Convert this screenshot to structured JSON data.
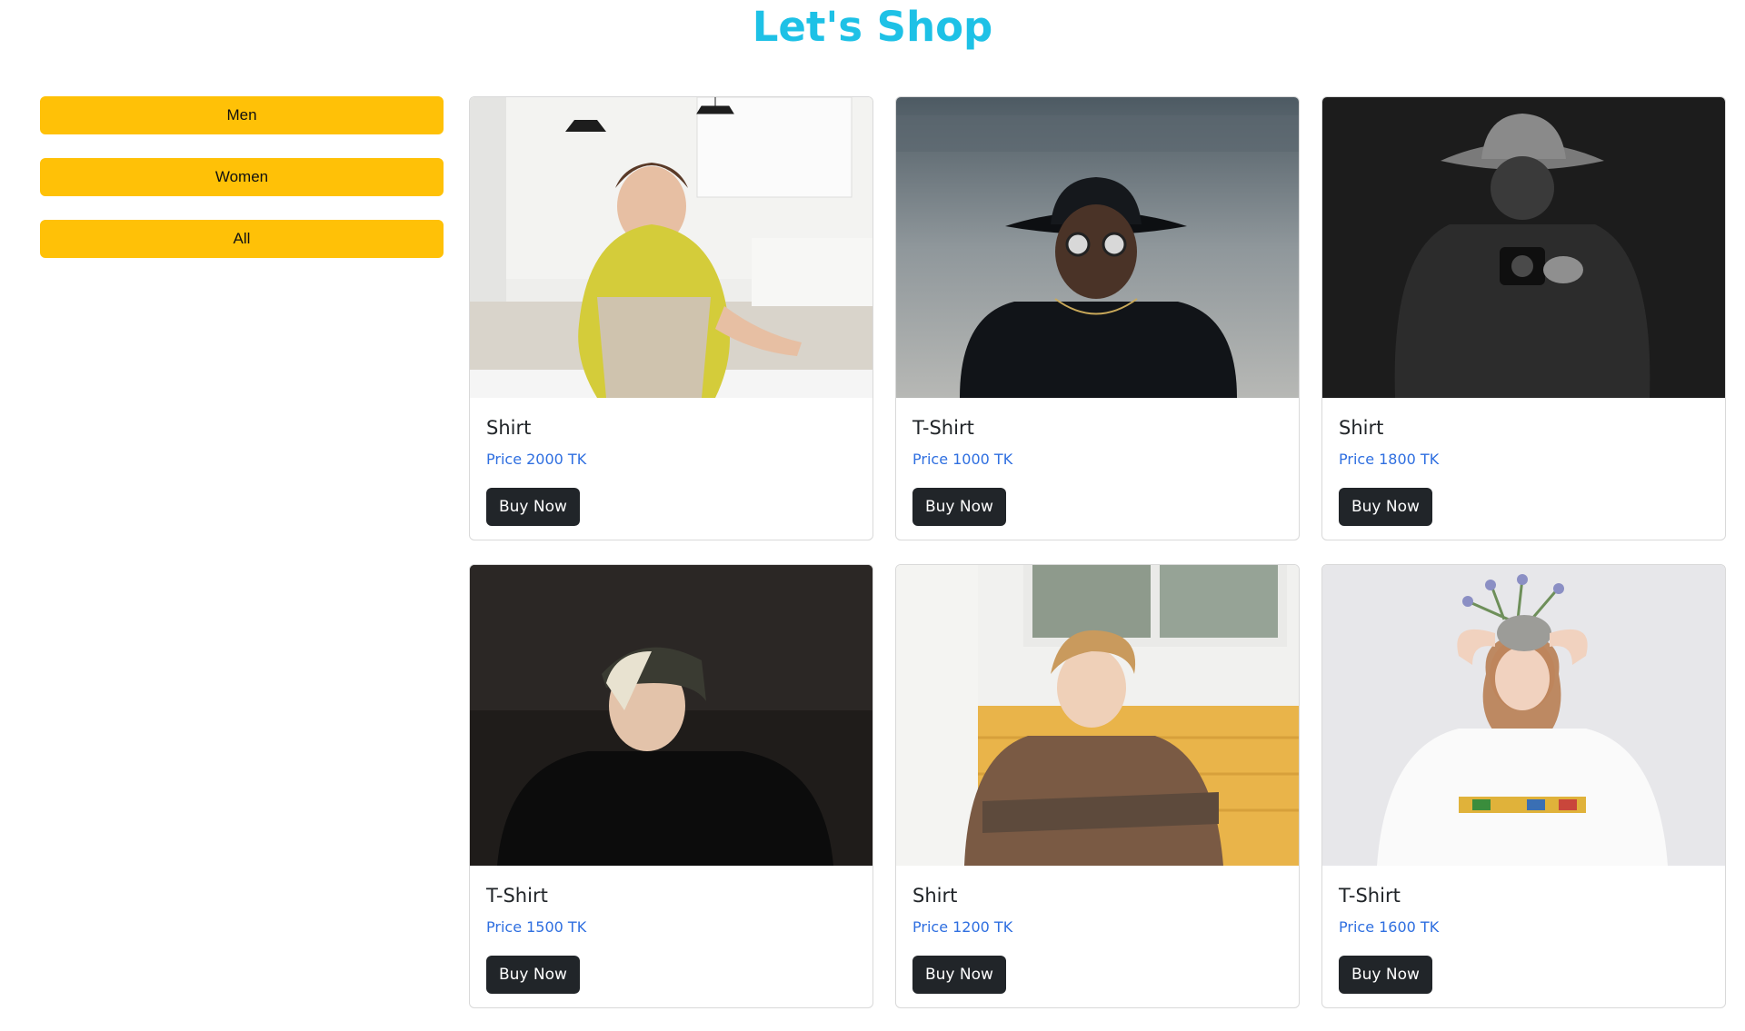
{
  "header": {
    "title": "Let's Shop"
  },
  "filters": [
    {
      "label": "Men"
    },
    {
      "label": "Women"
    },
    {
      "label": "All"
    }
  ],
  "colors": {
    "title": "#1ec1e6",
    "filter_button": "#ffc107",
    "price": "#2f6fe0",
    "buy_button": "#212529"
  },
  "products": [
    {
      "name": "Shirt",
      "price": "Price 2000 TK",
      "button": "Buy Now",
      "photo": "woman in yellow shirt in kitchen"
    },
    {
      "name": "T-Shirt",
      "price": "Price 1000 TK",
      "button": "Buy Now",
      "photo": "man in black hat and sunglasses"
    },
    {
      "name": "Shirt",
      "price": "Price 1800 TK",
      "button": "Buy Now",
      "photo": "man in hat holding camera, black and white"
    },
    {
      "name": "T-Shirt",
      "price": "Price 1500 TK",
      "button": "Buy Now",
      "photo": "person in beanie in dark room"
    },
    {
      "name": "Shirt",
      "price": "Price 1200 TK",
      "button": "Buy Now",
      "photo": "curly-haired boy in plaid shirt"
    },
    {
      "name": "T-Shirt",
      "price": "Price 1600 TK",
      "button": "Buy Now",
      "photo": "girl with plant pot on head"
    }
  ]
}
